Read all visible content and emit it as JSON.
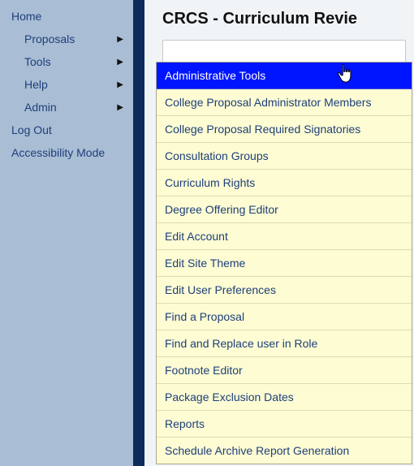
{
  "sidebar": {
    "items": [
      {
        "label": "Home",
        "hasSubmenu": false,
        "indent": false
      },
      {
        "label": "Proposals",
        "hasSubmenu": true,
        "indent": true
      },
      {
        "label": "Tools",
        "hasSubmenu": true,
        "indent": true
      },
      {
        "label": "Help",
        "hasSubmenu": true,
        "indent": true
      },
      {
        "label": "Admin",
        "hasSubmenu": true,
        "indent": true
      },
      {
        "label": "Log Out",
        "hasSubmenu": false,
        "indent": false
      },
      {
        "label": "Accessibility Mode",
        "hasSubmenu": false,
        "indent": false
      }
    ]
  },
  "main": {
    "title": "CRCS - Curriculum Revie"
  },
  "submenu": {
    "highlightedIndex": 0,
    "items": [
      "Administrative Tools",
      "College Proposal Administrator Members",
      "College Proposal Required Signatories",
      "Consultation Groups",
      "Curriculum Rights",
      "Degree Offering Editor",
      "Edit Account",
      "Edit Site Theme",
      "Edit User Preferences",
      "Find a Proposal",
      "Find and Replace user in Role",
      "Footnote Editor",
      "Package Exclusion Dates",
      "Reports",
      "Schedule Archive Report Generation"
    ]
  },
  "icons": {
    "submenuArrow": "▶",
    "cursor": "pointer-hand"
  }
}
